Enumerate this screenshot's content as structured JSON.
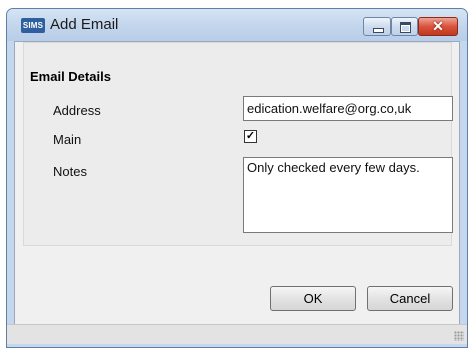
{
  "window": {
    "app_icon_text": "SIMS",
    "title": "Add Email",
    "controls": {
      "minimize": "minimize-icon",
      "maximize": "maximize-icon",
      "close": "close-icon",
      "close_glyph": "✕"
    }
  },
  "form": {
    "group_title": "Email Details",
    "address_label": "Address",
    "address_value": "edication.welfare@org.co,uk",
    "main_label": "Main",
    "main_checked": true,
    "main_check_glyph": "✓",
    "notes_label": "Notes",
    "notes_value": "Only checked every few days."
  },
  "buttons": {
    "ok": "OK",
    "cancel": "Cancel"
  },
  "colors": {
    "title_bar": "#c2d5ec",
    "close_button": "#d9543c",
    "dialog_bg": "#f0f0f0"
  }
}
